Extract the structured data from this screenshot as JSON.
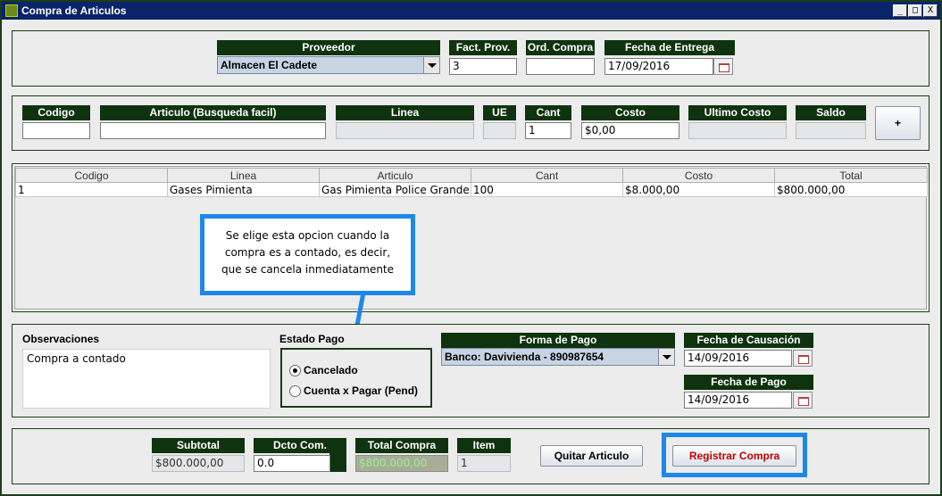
{
  "window": {
    "title": "Compra de Articulos",
    "min_glyph": "_",
    "max_glyph": "□",
    "close_glyph": "X"
  },
  "header": {
    "proveedor_label": "Proveedor",
    "proveedor_value": "Almacen El Cadete",
    "fact_prov_label": "Fact. Prov.",
    "fact_prov_value": "3",
    "ord_compra_label": "Ord. Compra",
    "ord_compra_value": "",
    "fecha_entrega_label": "Fecha de Entrega",
    "fecha_entrega_value": "17/09/2016"
  },
  "item_entry": {
    "codigo_label": "Codigo",
    "codigo_value": "",
    "articulo_label": "Articulo (Busqueda facil)",
    "articulo_value": "",
    "linea_label": "Linea",
    "linea_value": "",
    "ue_label": "UE",
    "ue_value": "",
    "cant_label": "Cant",
    "cant_value": "1",
    "costo_label": "Costo",
    "costo_value": "$0,00",
    "ultimo_costo_label": "Ultimo Costo",
    "ultimo_costo_value": "",
    "saldo_label": "Saldo",
    "saldo_value": "",
    "add_button": "+"
  },
  "table": {
    "columns": [
      "Codigo",
      "Linea",
      "Articulo",
      "Cant",
      "Costo",
      "Total"
    ],
    "rows": [
      [
        "1",
        "Gases Pimienta",
        "Gas Pimienta Police Grande",
        "100",
        "$8.000,00",
        "$800.000,00"
      ]
    ]
  },
  "callout": {
    "line1": "Se elige esta opcion cuando la",
    "line2": "compra es a contado, es decir,",
    "line3": "que se cancela inmediatamente"
  },
  "observaciones": {
    "label": "Observaciones",
    "value": "Compra a contado"
  },
  "estado_pago": {
    "label": "Estado Pago",
    "option_cancelado": "Cancelado",
    "option_pendiente": "Cuenta x Pagar (Pend)",
    "selected": "Cancelado"
  },
  "forma_pago": {
    "label": "Forma de Pago",
    "value": "Banco: Davivienda - 890987654"
  },
  "fecha_causacion": {
    "label": "Fecha de Causación",
    "value": "14/09/2016"
  },
  "fecha_pago": {
    "label": "Fecha de Pago",
    "value": "14/09/2016"
  },
  "totals": {
    "subtotal_label": "Subtotal",
    "subtotal_value": "$800.000,00",
    "dcto_label": "Dcto Com.",
    "dcto_value": "0.0",
    "total_label": "Total Compra",
    "total_value": "$800.000,00",
    "item_label": "Item",
    "item_value": "1"
  },
  "buttons": {
    "quitar": "Quitar Articulo",
    "registrar": "Registrar Compra"
  },
  "colors": {
    "header_bg": "#0e330e",
    "titlebar_bg": "#0a246a",
    "highlight_blue": "#1e88e8",
    "total_text": "#9cf08a",
    "register_text": "#c00000"
  }
}
